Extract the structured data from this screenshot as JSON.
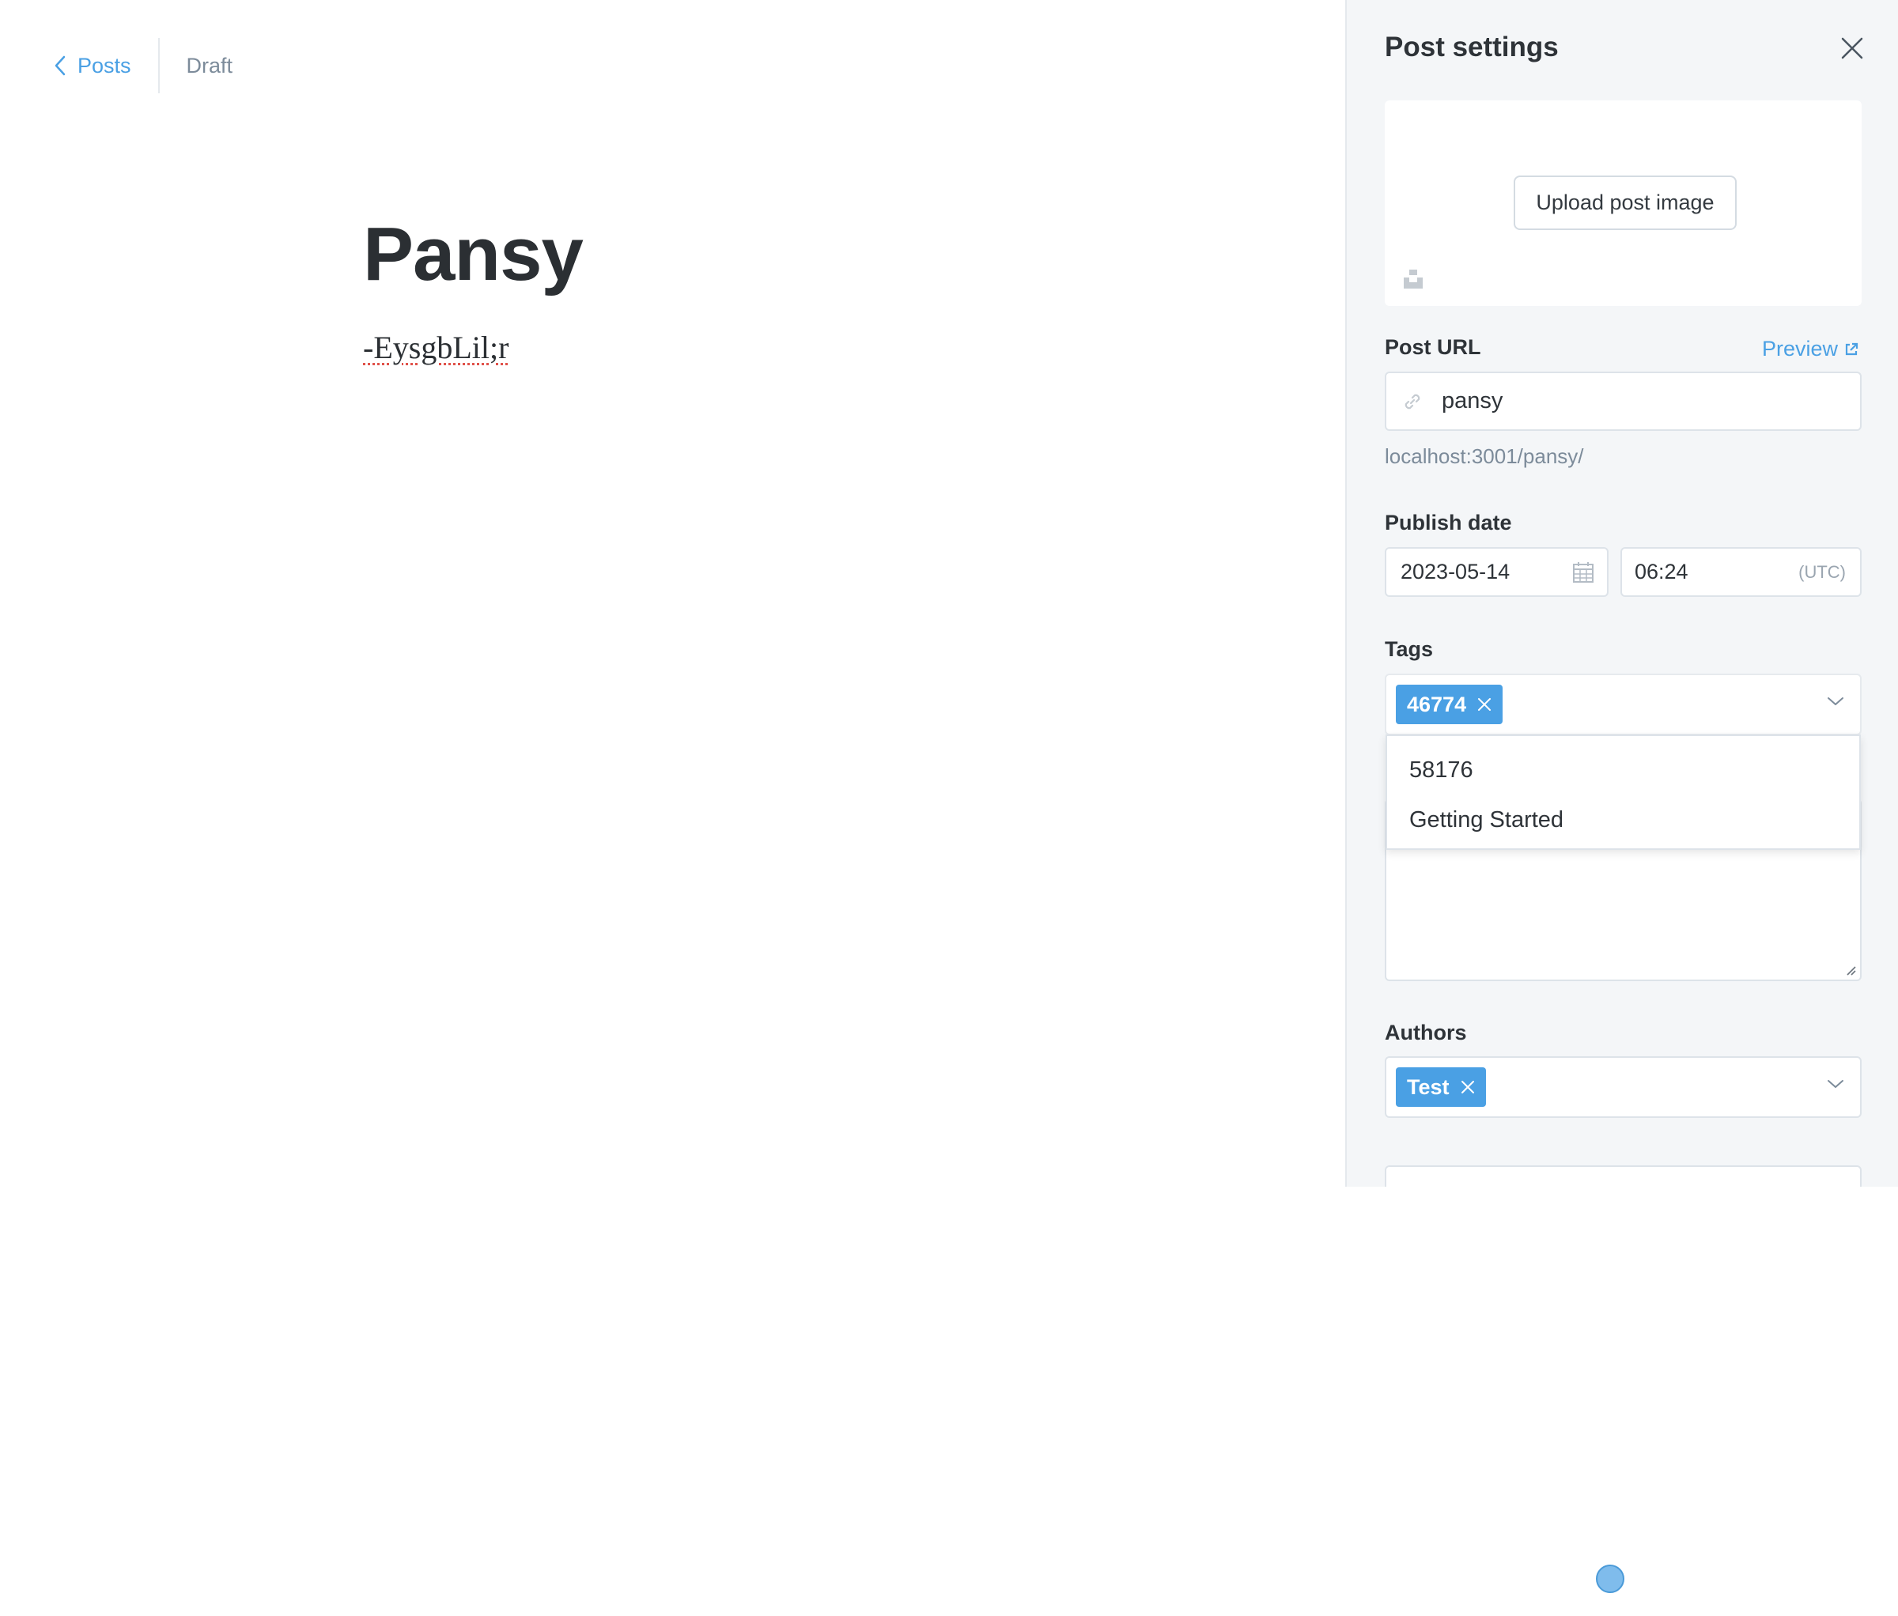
{
  "editor": {
    "back_label": "Posts",
    "status": "Draft",
    "title": "Pansy",
    "body": "-EysgbLil;r"
  },
  "settings": {
    "title": "Post settings",
    "upload_label": "Upload post image",
    "post_url": {
      "label": "Post URL",
      "preview_label": "Preview",
      "value": "pansy",
      "hint": "localhost:3001/pansy/"
    },
    "publish_date": {
      "label": "Publish date",
      "date": "2023-05-14",
      "time": "06:24",
      "timezone": "(UTC)"
    },
    "tags": {
      "label": "Tags",
      "selected": [
        "46774"
      ],
      "options": [
        "58176",
        "Getting Started"
      ]
    },
    "authors": {
      "label": "Authors",
      "selected": [
        "Test"
      ]
    }
  },
  "colors": {
    "accent": "#4aa0e4",
    "panel_bg": "#f4f6f8",
    "text": "#2e3338",
    "muted": "#7c8b9a"
  },
  "icons": [
    "chevron-left-icon",
    "close-icon",
    "unsplash-icon",
    "link-icon",
    "external-link-icon",
    "calendar-icon",
    "token-remove-icon",
    "chevron-down-icon",
    "resize-handle-icon"
  ]
}
